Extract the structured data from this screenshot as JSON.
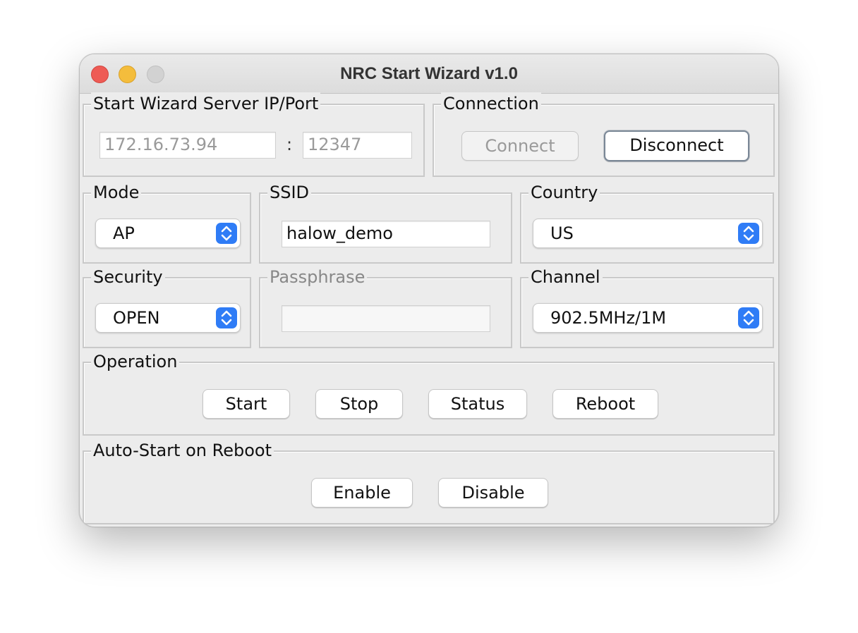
{
  "window": {
    "title": "NRC Start Wizard v1.0"
  },
  "server": {
    "group_label": "Start Wizard Server IP/Port",
    "ip": "172.16.73.94",
    "separator": ":",
    "port": "12347"
  },
  "connection": {
    "group_label": "Connection",
    "connect_label": "Connect",
    "disconnect_label": "Disconnect"
  },
  "mode": {
    "group_label": "Mode",
    "selected": "AP"
  },
  "ssid": {
    "group_label": "SSID",
    "value": "halow_demo"
  },
  "country": {
    "group_label": "Country",
    "selected": "US"
  },
  "security": {
    "group_label": "Security",
    "selected": "OPEN"
  },
  "passphrase": {
    "group_label": "Passphrase",
    "value": ""
  },
  "channel": {
    "group_label": "Channel",
    "selected": "902.5MHz/1M"
  },
  "operation": {
    "group_label": "Operation",
    "start_label": "Start",
    "stop_label": "Stop",
    "status_label": "Status",
    "reboot_label": "Reboot"
  },
  "autostart": {
    "group_label": "Auto-Start on Reboot",
    "enable_label": "Enable",
    "disable_label": "Disable"
  },
  "colors": {
    "close": "#ee5b55",
    "minimize": "#f4bd3c",
    "zoom_disabled": "#d2d2d2",
    "select_accent": "#2f7cf6"
  }
}
